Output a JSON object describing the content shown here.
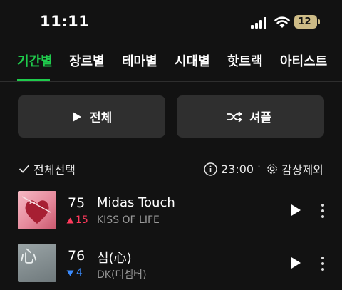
{
  "status_bar": {
    "time": "11:11",
    "battery": "12",
    "signal_icon": "cellular-signal-icon",
    "wifi_icon": "wifi-icon"
  },
  "tabs": [
    {
      "label": "기간별",
      "active": true
    },
    {
      "label": "장르별",
      "active": false
    },
    {
      "label": "테마별",
      "active": false
    },
    {
      "label": "시대별",
      "active": false
    },
    {
      "label": "핫트랙",
      "active": false
    },
    {
      "label": "아티스트",
      "active": false
    }
  ],
  "actions": {
    "play_all_label": "전체",
    "shuffle_label": "셔플"
  },
  "toolbar": {
    "select_all_label": "전체선택",
    "chart_time": "23:00",
    "separator": "·",
    "exclude_label": "감상제외"
  },
  "songs": [
    {
      "rank": "75",
      "change": "15",
      "change_direction": "up",
      "title": "Midas Touch",
      "artist": "KISS OF LIFE"
    },
    {
      "rank": "76",
      "change": "4",
      "change_direction": "down",
      "title": "심(心)",
      "artist": "DK(디셈버)",
      "art_text": "心"
    }
  ],
  "colors": {
    "accent": "#1fcb4c",
    "up": "#ff3a5c",
    "down": "#3b8cff",
    "background": "#121212",
    "button": "#2f2f2f"
  }
}
